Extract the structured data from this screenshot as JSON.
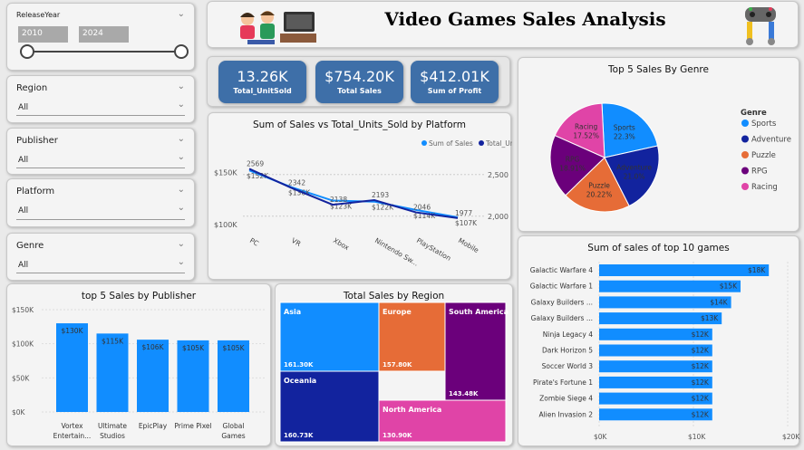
{
  "header": {
    "title": "Video Games Sales Analysis"
  },
  "filters": {
    "release_year": {
      "label": "ReleaseYear",
      "from": "2010",
      "to": "2024"
    },
    "region": {
      "label": "Region",
      "value": "All"
    },
    "publisher": {
      "label": "Publisher",
      "value": "All"
    },
    "platform": {
      "label": "Platform",
      "value": "All"
    },
    "genre": {
      "label": "Genre",
      "value": "All"
    }
  },
  "kpis": [
    {
      "value": "13.26K",
      "label": "Total_UnitSold"
    },
    {
      "value": "$754.20K",
      "label": "Total Sales"
    },
    {
      "value": "$412.01K",
      "label": "Sum of Profit"
    }
  ],
  "colors": {
    "accent": "#118dff",
    "navy": "#12239e",
    "orange": "#e66c37",
    "purple": "#6b007b",
    "pink": "#e044a7",
    "kpi": "#3e6fa8"
  },
  "chart_data": [
    {
      "id": "platform",
      "type": "line",
      "title": "Sum of Sales vs Total_Units_Sold by Platform",
      "categories": [
        "PC",
        "VR",
        "Xbox",
        "Nintendo Sw...",
        "PlayStation",
        "Mobile"
      ],
      "series": [
        {
          "name": "Sum of Sales",
          "values": [
            152000,
            136000,
            123000,
            122000,
            114000,
            107000
          ],
          "labels": [
            "$152K",
            "$136K",
            "$123K",
            "$122K",
            "$114K",
            "$107K"
          ],
          "color": "#118dff",
          "axis": "left"
        },
        {
          "name": "Total_UnitSold",
          "values": [
            2569,
            2342,
            2138,
            2193,
            2046,
            1977
          ],
          "labels": [
            "2569",
            "2342",
            "2138",
            "2193",
            "2046",
            "1977"
          ],
          "color": "#12239e",
          "axis": "right"
        }
      ],
      "ylim": [
        100000,
        160000
      ],
      "y2lim": [
        1900,
        2650
      ],
      "yticks": [
        "$150K",
        "$100K"
      ],
      "y2ticks": [
        "2,500",
        "2,000"
      ],
      "legend": "top-left"
    },
    {
      "id": "genre",
      "type": "pie",
      "title": "Top 5 Sales By Genre",
      "legend_title": "Genre",
      "legend": "right",
      "slices": [
        {
          "label": "Sports",
          "value": 22.3,
          "text": "22.3%",
          "color": "#118dff"
        },
        {
          "label": "Adventure",
          "value": 21.0,
          "text": "21.0%",
          "color": "#12239e"
        },
        {
          "label": "Puzzle",
          "value": 20.22,
          "text": "20.22%",
          "color": "#e66c37"
        },
        {
          "label": "RPG",
          "value": 18.91,
          "text": "18.91%",
          "color": "#6b007b"
        },
        {
          "label": "Racing",
          "value": 17.52,
          "text": "17.52%",
          "color": "#e044a7"
        }
      ]
    },
    {
      "id": "publisher",
      "type": "bar",
      "title": "top 5 Sales by Publisher",
      "categories": [
        [
          "Vortex",
          "Entertain..."
        ],
        [
          "Ultimate",
          "Studios"
        ],
        [
          "EpicPlay"
        ],
        [
          "Prime Pixel"
        ],
        [
          "Global",
          "Games"
        ]
      ],
      "values": [
        130000,
        115000,
        106000,
        105000,
        105000
      ],
      "labels": [
        "$130K",
        "$115K",
        "$106K",
        "$105K",
        "$105K"
      ],
      "ylim": [
        0,
        150000
      ],
      "yticks": [
        "$0K",
        "$50K",
        "$100K",
        "$150K"
      ]
    },
    {
      "id": "region",
      "type": "treemap",
      "title": "Total Sales by Region",
      "cells": [
        {
          "name": "Asia",
          "value": 161300,
          "text": "161.30K",
          "color": "#118dff"
        },
        {
          "name": "Oceania",
          "value": 160730,
          "text": "160.73K",
          "color": "#12239e"
        },
        {
          "name": "Europe",
          "value": 157800,
          "text": "157.80K",
          "color": "#e66c37"
        },
        {
          "name": "North America",
          "value": 130900,
          "text": "130.90K",
          "color": "#e044a7"
        },
        {
          "name": "South America",
          "value": 143480,
          "text": "143.48K",
          "color": "#6b007b"
        }
      ]
    },
    {
      "id": "games",
      "type": "bar",
      "orientation": "horizontal",
      "title": "Sum of sales of top 10 games",
      "categories": [
        "Galactic Warfare 4",
        "Galactic Warfare 1",
        "Galaxy Builders ...",
        "Galaxy Builders ...",
        "Ninja Legacy 4",
        "Dark Horizon 5",
        "Soccer World 3",
        "Pirate's Fortune 1",
        "Zombie Siege 4",
        "Alien Invasion 2"
      ],
      "values": [
        18000,
        15000,
        14000,
        13000,
        12000,
        12000,
        12000,
        12000,
        12000,
        12000
      ],
      "labels": [
        "$18K",
        "$15K",
        "$14K",
        "$13K",
        "$12K",
        "$12K",
        "$12K",
        "$12K",
        "$12K",
        "$12K"
      ],
      "xlim": [
        0,
        20000
      ],
      "xticks": [
        "$0K",
        "$10K",
        "$20K"
      ]
    }
  ]
}
